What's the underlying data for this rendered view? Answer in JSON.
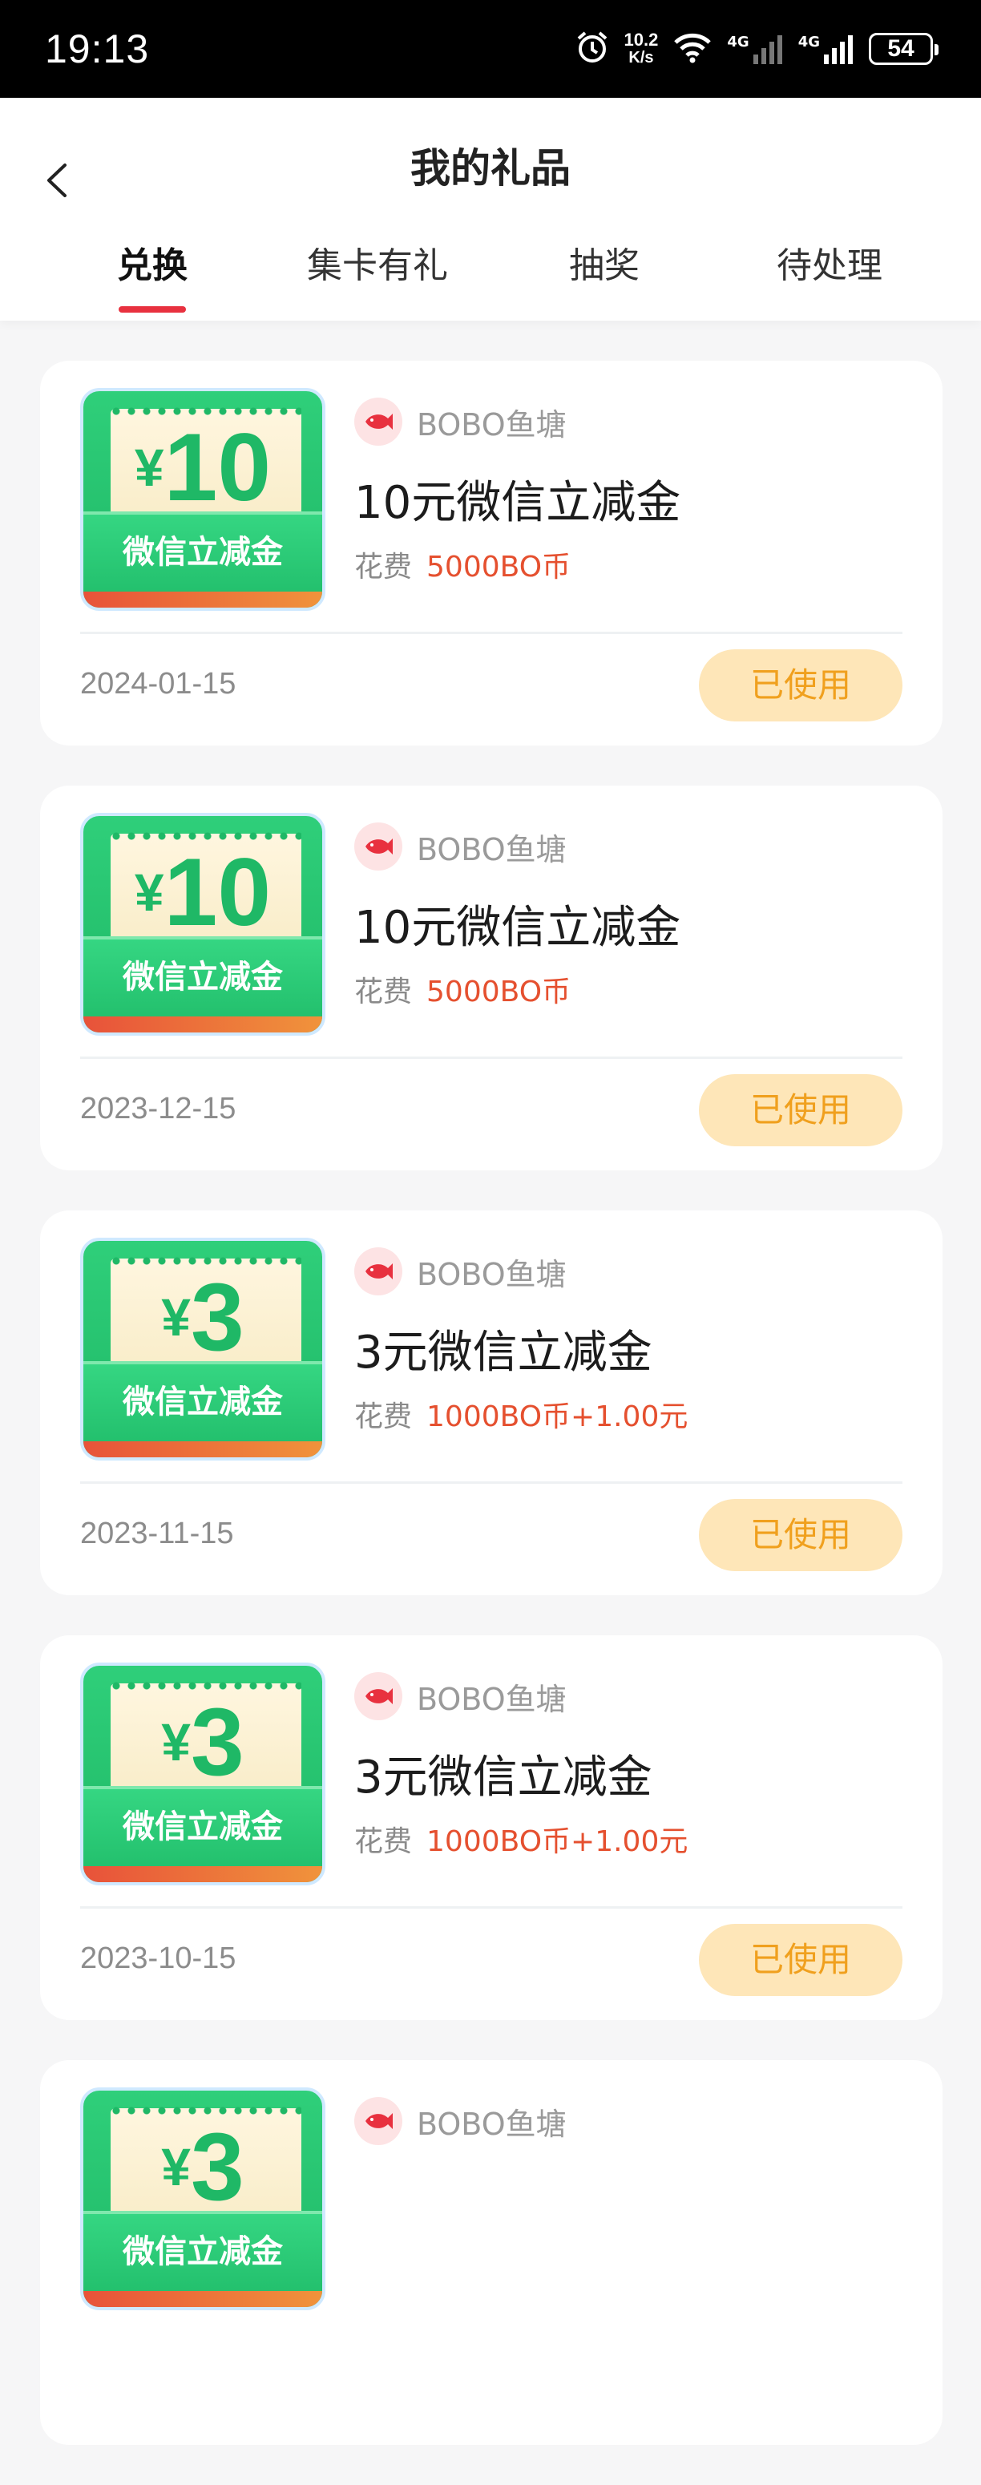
{
  "status_bar": {
    "time": "19:13",
    "net_speed_value": "10.2",
    "net_speed_unit": "K/s",
    "network_1": "4G",
    "network_2": "4G",
    "battery": "54"
  },
  "header": {
    "title": "我的礼品",
    "tabs": [
      {
        "label": "兑换",
        "active": true
      },
      {
        "label": "集卡有礼",
        "active": false
      },
      {
        "label": "抽奖",
        "active": false
      },
      {
        "label": "待处理",
        "active": false
      }
    ]
  },
  "gifts": [
    {
      "thumb_currency": "¥",
      "thumb_amount": "10",
      "thumb_caption": "微信立减金",
      "shop": "BOBO鱼塘",
      "name": "10元微信立减金",
      "cost_label": "花费",
      "cost": "5000BO币",
      "date": "2024-01-15",
      "status": "已使用"
    },
    {
      "thumb_currency": "¥",
      "thumb_amount": "10",
      "thumb_caption": "微信立减金",
      "shop": "BOBO鱼塘",
      "name": "10元微信立减金",
      "cost_label": "花费",
      "cost": "5000BO币",
      "date": "2023-12-15",
      "status": "已使用"
    },
    {
      "thumb_currency": "¥",
      "thumb_amount": "3",
      "thumb_caption": "微信立减金",
      "shop": "BOBO鱼塘",
      "name": "3元微信立减金",
      "cost_label": "花费",
      "cost": "1000BO币+1.00元",
      "date": "2023-11-15",
      "status": "已使用"
    },
    {
      "thumb_currency": "¥",
      "thumb_amount": "3",
      "thumb_caption": "微信立减金",
      "shop": "BOBO鱼塘",
      "name": "3元微信立减金",
      "cost_label": "花费",
      "cost": "1000BO币+1.00元",
      "date": "2023-10-15",
      "status": "已使用"
    },
    {
      "thumb_currency": "¥",
      "thumb_amount": "3",
      "thumb_caption": "微信立减金",
      "shop": "BOBO鱼塘",
      "name": "",
      "cost_label": "",
      "cost": "",
      "date": "",
      "status": ""
    }
  ],
  "colors": {
    "accent_red": "#e8313f",
    "cost_orange": "#e5502f",
    "status_bg": "#fee6b8",
    "status_text": "#f0a01e",
    "voucher_green": "#1fb866"
  }
}
